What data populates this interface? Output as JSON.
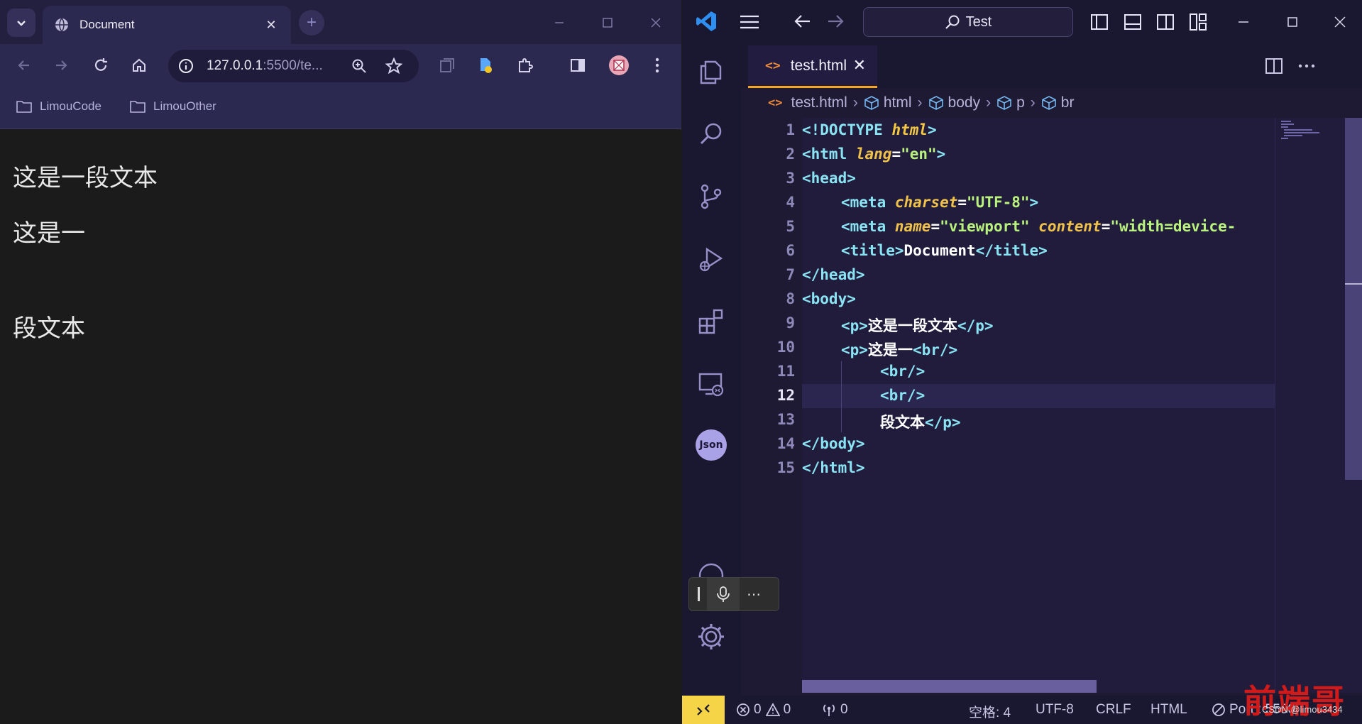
{
  "browser": {
    "tab_title": "Document",
    "new_tab_symbol": "+",
    "url_host": "127.0.0.1",
    "url_rest": ":5500/te...",
    "bookmarks": [
      "LimouCode",
      "LimouOther"
    ],
    "page_paragraphs": [
      "这是一段文本",
      "这是一",
      "段文本"
    ]
  },
  "vscode": {
    "command_center": "Test",
    "tab_name": "test.html",
    "tab_close": "✕",
    "breadcrumbs": [
      "test.html",
      "html",
      "body",
      "p",
      "br"
    ],
    "line_numbers": [
      "1",
      "2",
      "3",
      "4",
      "5",
      "6",
      "7",
      "8",
      "9",
      "10",
      "11",
      "12",
      "13",
      "14",
      "15"
    ],
    "active_line": "12",
    "code": {
      "l1_a": "<!DOCTYPE ",
      "l1_b": "html",
      "l1_c": ">",
      "l2_a": "<html ",
      "l2_b": "lang",
      "l2_c": "=",
      "l2_d": "\"en\"",
      "l2_e": ">",
      "l3": "<head>",
      "l4_a": "<meta ",
      "l4_b": "charset",
      "l4_c": "=",
      "l4_d": "\"UTF-8\"",
      "l4_e": ">",
      "l5_a": "<meta ",
      "l5_b": "name",
      "l5_c": "=",
      "l5_d": "\"viewport\"",
      "l5_e": " content",
      "l5_f": "=",
      "l5_g": "\"width=device-",
      "l6_a": "<title>",
      "l6_b": "Document",
      "l6_c": "</title>",
      "l7": "</head>",
      "l8": "<body>",
      "l9_a": "<p>",
      "l9_b": "这是一段文本",
      "l9_c": "</p>",
      "l10_a": "<p>",
      "l10_b": "这是一",
      "l10_c": "<br/>",
      "l11": "<br/>",
      "l12": "<br/>",
      "l13_a": "段文本",
      "l13_b": "</p>",
      "l14": "</body>",
      "l15": "</html>"
    },
    "status": {
      "errors": "0",
      "warnings": "0",
      "ports": "0",
      "indent": "空格: 4",
      "encoding": "UTF-8",
      "eol": "CRLF",
      "language": "HTML",
      "port_label": "Port : 5500"
    },
    "json_badge": "Json"
  },
  "watermark": {
    "text": "前端哥",
    "sub": "CSDN @limou3434"
  },
  "colors": {
    "tab_accent": "#f5a623",
    "tag": "#8ae3f2",
    "attr": "#f0c24a",
    "string": "#b9f27c",
    "remote_button": "#f5d547"
  }
}
